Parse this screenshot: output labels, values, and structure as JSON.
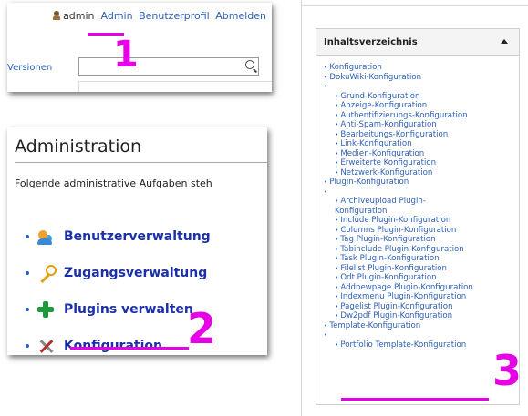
{
  "userbar": {
    "username": "admin",
    "links": [
      "Admin",
      "Benutzerprofil",
      "Abmelden"
    ]
  },
  "toolbar": {
    "versions_label": "Versionen",
    "search_placeholder": ""
  },
  "annotations": [
    "1",
    "2",
    "3"
  ],
  "admin": {
    "title": "Administration",
    "intro": "Folgende administrative Aufgaben steh",
    "items": [
      {
        "label": "Benutzerverwaltung",
        "icon": "users-icon"
      },
      {
        "label": "Zugangsverwaltung",
        "icon": "key-icon"
      },
      {
        "label": "Plugins verwalten",
        "icon": "plugin-icon"
      },
      {
        "label": "Konfiguration",
        "icon": "tools-icon"
      }
    ]
  },
  "toc": {
    "title": "Inhaltsverzeichnis",
    "sections": [
      {
        "label": "Konfiguration",
        "children": []
      },
      {
        "label": "DokuWiki-Konfiguration",
        "children": [
          "Grund-Konfiguration",
          "Anzeige-Konfiguration",
          "Authentifizierungs-Konfiguration",
          "Anti-Spam-Konfiguration",
          "Bearbeitungs-Konfiguration",
          "Link-Konfiguration",
          "Medien-Konfiguration",
          "Erweiterte Konfiguration",
          "Netzwerk-Konfiguration"
        ]
      },
      {
        "label": "Plugin-Konfiguration",
        "children": [
          "Archiveupload Plugin-Konfiguration",
          "Include Plugin-Konfiguration",
          "Columns Plugin-Konfiguration",
          "Tag Plugin-Konfiguration",
          "Tabinclude Plugin-Konfiguration",
          "Task Plugin-Konfiguration",
          "Filelist Plugin-Konfiguration",
          "Odt Plugin-Konfiguration",
          "Addnewpage Plugin-Konfiguration",
          "Indexmenu Plugin-Konfiguration",
          "Pagelist Plugin-Konfiguration",
          "Dw2pdf Plugin-Konfiguration"
        ]
      },
      {
        "label": "Template-Konfiguration",
        "children": [
          "Portfolio Template-Konfiguration"
        ]
      }
    ]
  },
  "colors": {
    "link": "#2b5fb5",
    "annotation": "#e600e6",
    "admin_link": "#1a2fa8"
  }
}
